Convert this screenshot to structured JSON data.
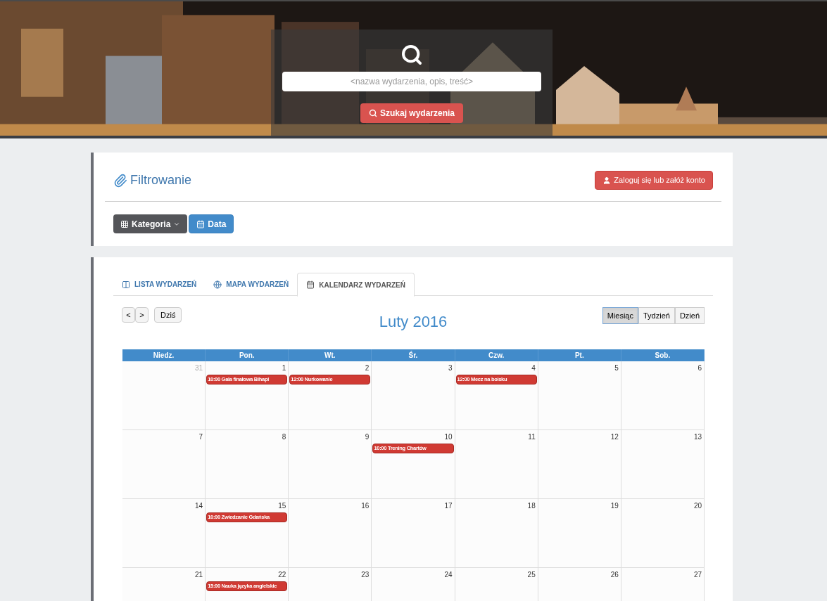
{
  "hero": {
    "kind": "picture",
    "search": {
      "placeholder": "<nazwa wydarzenia, opis, treść>",
      "button": "Szukaj wydarzenia"
    }
  },
  "filter": {
    "title": "Filtrowanie",
    "login_button": "Zaloguj się lub załóż konto",
    "buttons": [
      {
        "label": "Kategoria",
        "kind": "dropdown"
      },
      {
        "label": "Data",
        "kind": "date"
      }
    ]
  },
  "tabs": [
    {
      "label": "LISTA WYDARZEŃ",
      "kind": "list",
      "selected": false
    },
    {
      "label": "MAPA WYDARZEŃ",
      "kind": "map",
      "selected": false
    },
    {
      "label": "KALENDARZ WYDARZEŃ",
      "kind": "calendar",
      "selected": true
    }
  ],
  "calendar": {
    "nav": [
      "<",
      ">"
    ],
    "today": "Dziś",
    "title": "Luty 2016",
    "views": [
      {
        "label": "Miesiąc",
        "selected": true
      },
      {
        "label": "Tydzień",
        "selected": false
      },
      {
        "label": "Dzień",
        "selected": false
      }
    ],
    "weekdays": [
      "Niedz.",
      "Pon.",
      "Wt.",
      "Śr.",
      "Czw.",
      "Pt.",
      "Sob."
    ],
    "weeks": [
      [
        {
          "day": "31",
          "other_month": true
        },
        {
          "day": "1",
          "other_month": false,
          "events": [
            "10:00 Gala finałowa Bihapi"
          ]
        },
        {
          "day": "2",
          "other_month": false,
          "events": [
            "12:00 Nurkowanie"
          ]
        },
        {
          "day": "3",
          "other_month": false
        },
        {
          "day": "4",
          "other_month": false,
          "events": [
            "12:00 Mecz na boisku"
          ]
        },
        {
          "day": "5",
          "other_month": false
        },
        {
          "day": "6",
          "other_month": false
        }
      ],
      [
        {
          "day": "7",
          "other_month": false
        },
        {
          "day": "8",
          "other_month": false
        },
        {
          "day": "9",
          "other_month": false
        },
        {
          "day": "10",
          "other_month": false,
          "events": [
            "10:00 Trening Chartów"
          ]
        },
        {
          "day": "11",
          "other_month": false
        },
        {
          "day": "12",
          "other_month": false
        },
        {
          "day": "13",
          "other_month": false
        }
      ],
      [
        {
          "day": "14",
          "other_month": false
        },
        {
          "day": "15",
          "other_month": false,
          "events": [
            "10:00 Zwiedzanie Gdańska"
          ]
        },
        {
          "day": "16",
          "other_month": false
        },
        {
          "day": "17",
          "other_month": false
        },
        {
          "day": "18",
          "other_month": false
        },
        {
          "day": "19",
          "other_month": false
        },
        {
          "day": "20",
          "other_month": false
        }
      ],
      [
        {
          "day": "21",
          "other_month": false
        },
        {
          "day": "22",
          "other_month": false,
          "events": [
            "15:00 Nauka języka angielskie"
          ]
        },
        {
          "day": "23",
          "other_month": false
        },
        {
          "day": "24",
          "other_month": false
        },
        {
          "day": "25",
          "other_month": false
        },
        {
          "day": "26",
          "other_month": false
        },
        {
          "day": "27",
          "other_month": false
        }
      ]
    ]
  }
}
